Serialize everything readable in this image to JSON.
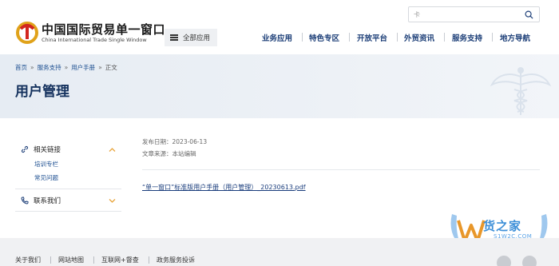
{
  "header": {
    "logo_cn": "中国国际贸易单一窗口",
    "logo_en": "China International Trade Single Window",
    "all_apps_label": "全部应用",
    "search_placeholder": "卡",
    "nav": [
      "业务应用",
      "特色专区",
      "开放平台",
      "外贸资讯",
      "服务支持",
      "地方导航"
    ]
  },
  "breadcrumb": {
    "items": [
      "首页",
      "服务支持",
      "用户手册",
      "正文"
    ],
    "separator": "»"
  },
  "page_title": "用户管理",
  "sidebar": {
    "sections": [
      {
        "label": "相关链接",
        "expanded": true,
        "links": [
          "培训专栏",
          "常见问题"
        ]
      },
      {
        "label": "联系我们",
        "expanded": false,
        "links": []
      }
    ]
  },
  "article": {
    "publish_date": "发布日期：2023-06-13",
    "source": "文章来源：本站编辑",
    "attachment": "“单一窗口”标准版用户手册（用户管理）_20230613.pdf"
  },
  "watermark": {
    "main": "货之家",
    "sub": "S1W2C.COM"
  },
  "footer": {
    "links": [
      "关于我们",
      "网站地图",
      "互联网+督查",
      "政务服务投诉"
    ]
  },
  "colors": {
    "nav": "#1d3f78",
    "title": "#15325e",
    "link": "#1d4f91",
    "chevron": "#e8a43a",
    "watermark": "#3d8fd8"
  }
}
